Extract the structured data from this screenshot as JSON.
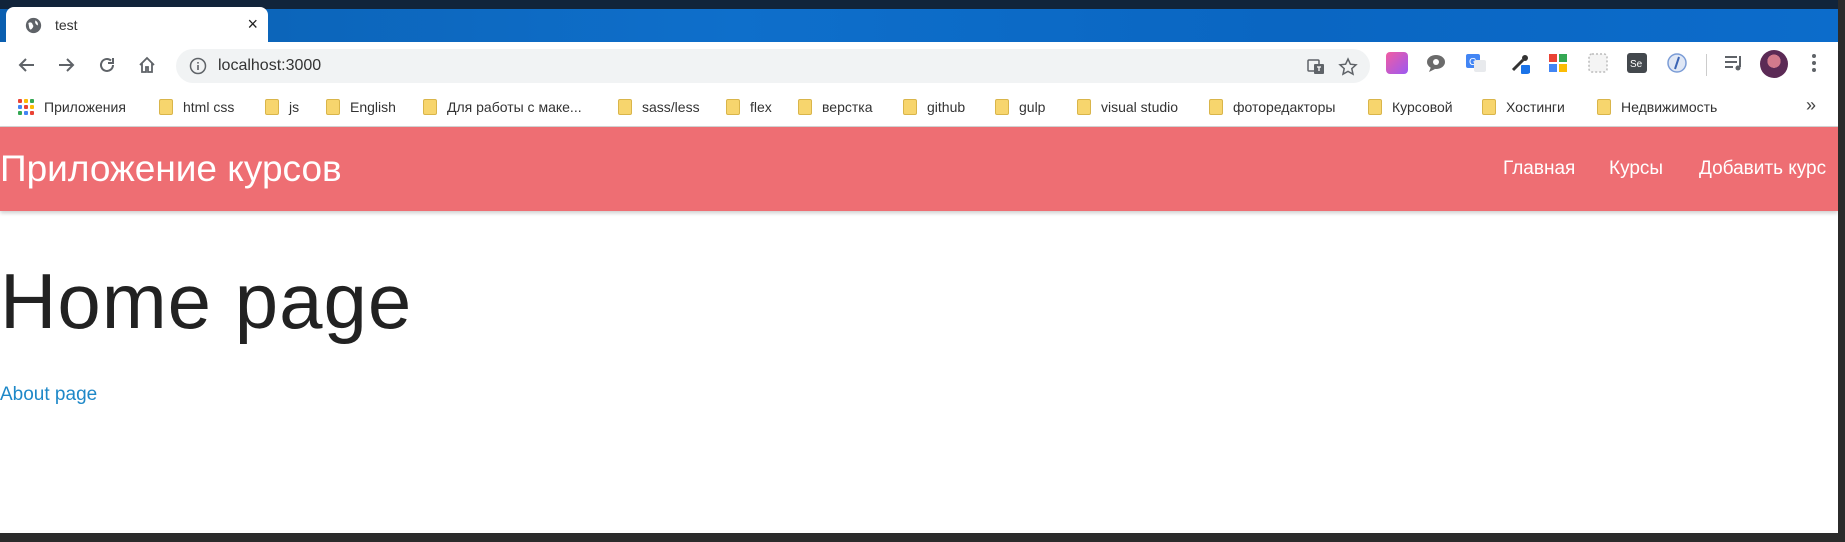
{
  "browser": {
    "tab_title": "test",
    "close_glyph": "×",
    "url": "localhost:3000",
    "bookmarks_more": "»",
    "bookmarks": [
      {
        "label": "Приложения",
        "icon": "apps-grid-icon"
      },
      {
        "label": "html css",
        "icon": "folder-icon"
      },
      {
        "label": "js",
        "icon": "folder-icon"
      },
      {
        "label": "English",
        "icon": "folder-icon"
      },
      {
        "label": "Для работы с маке...",
        "icon": "folder-icon"
      },
      {
        "label": "sass/less",
        "icon": "folder-icon"
      },
      {
        "label": "flex",
        "icon": "folder-icon"
      },
      {
        "label": "верстка",
        "icon": "folder-icon"
      },
      {
        "label": "github",
        "icon": "folder-icon"
      },
      {
        "label": "gulp",
        "icon": "folder-icon"
      },
      {
        "label": "visual studio",
        "icon": "folder-icon"
      },
      {
        "label": "фоторедакторы",
        "icon": "folder-icon"
      },
      {
        "label": "Курсовой",
        "icon": "folder-icon"
      },
      {
        "label": "Хостинги",
        "icon": "folder-icon"
      },
      {
        "label": "Недвижимость",
        "icon": "folder-icon"
      }
    ]
  },
  "app": {
    "brand": "Приложение курсов",
    "nav": [
      "Главная",
      "Курсы",
      "Добавить курс"
    ],
    "heading": "Home page",
    "link": "About page"
  },
  "colors": {
    "navbar": "#ee6e73",
    "link": "#1e88c8",
    "tabstrip": "#0e6fcb"
  }
}
